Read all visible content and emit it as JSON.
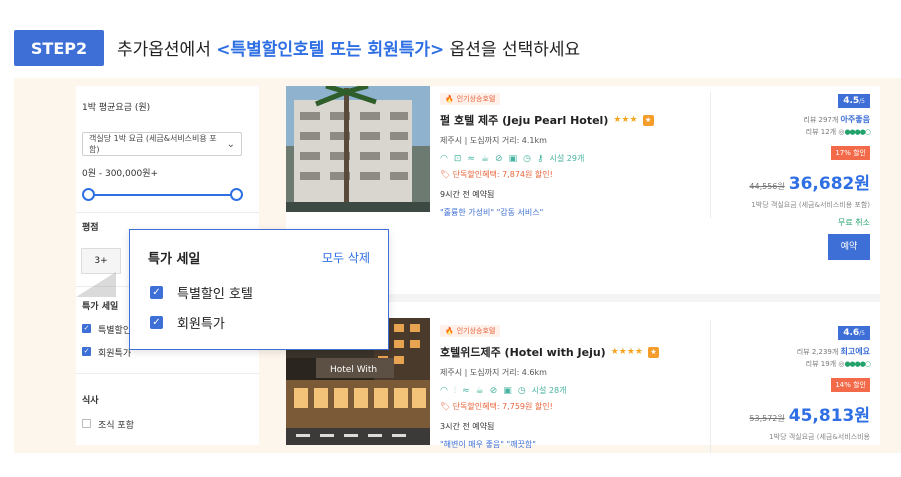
{
  "header": {
    "step_label": "STEP2",
    "title_prefix": "추가옵션에서 ",
    "title_highlight": "<특별할인호텔 또는 회원특가>",
    "title_suffix": " 옵션을 선택하세요"
  },
  "filters": {
    "price_label": "1박 평균요금 (원)",
    "price_select_value": "객실당 1박 요금 (세금&서비스비용 포함)",
    "price_range": "0원 - 300,000원+",
    "rating_label": "평점",
    "rating_value": "3+",
    "deal_label": "특가 세일",
    "deal_items": [
      "특별할인",
      "회원특가"
    ],
    "meal_label": "식사",
    "meal_item": "조식 포함"
  },
  "popup": {
    "title": "특가 세일",
    "clear_all": "모두 삭제",
    "options": [
      {
        "label": "특별할인 호텔",
        "checked": true
      },
      {
        "label": "회원특가",
        "checked": true
      }
    ]
  },
  "hotels": [
    {
      "tag": "인기상승호텔",
      "name": "펄 호텔 제주 (Jeju Pearl Hotel)",
      "stars": "★★★",
      "location": "제주시 | 도심까지 거리: 4.1km",
      "facilities": "시설 29개",
      "discount": "단독할인혜택: 7,874원 할인!",
      "booked": "9시간 전 예약됨",
      "reviews": "\"훌륭한 가성비\" \"감동 서비스\"",
      "score": "4.5",
      "score_max": "/5",
      "review_count": "리뷰 297개",
      "review_word": "아주좋음",
      "ta_count": "리뷰 12개",
      "sale": "17% 할인",
      "old_price": "44,556원",
      "new_price": "36,682원",
      "per_night": "1박당 객실요금 (세금&서비스비용 포함)",
      "free_cancel": "무료 취소",
      "book": "예약"
    },
    {
      "tag": "인기상승호텔",
      "name": "호텔위드제주 (Hotel with Jeju)",
      "stars": "★★★★",
      "location": "제주시 | 도심까지 거리: 4.6km",
      "facilities": "시설 28개",
      "discount": "단독할인혜택: 7,759원 할인!",
      "booked": "3시간 전 예약됨",
      "reviews": "\"해변이 매우 좋음\" \"깨끗함\"",
      "score": "4.6",
      "score_max": "/5",
      "review_count": "리뷰 2,239개",
      "review_word": "최고에요",
      "ta_count": "리뷰 19개",
      "sale": "14% 할인",
      "old_price": "53,572원",
      "new_price": "45,813원",
      "per_night": "1박당 객실요금 (세금&서비스비용"
    }
  ]
}
